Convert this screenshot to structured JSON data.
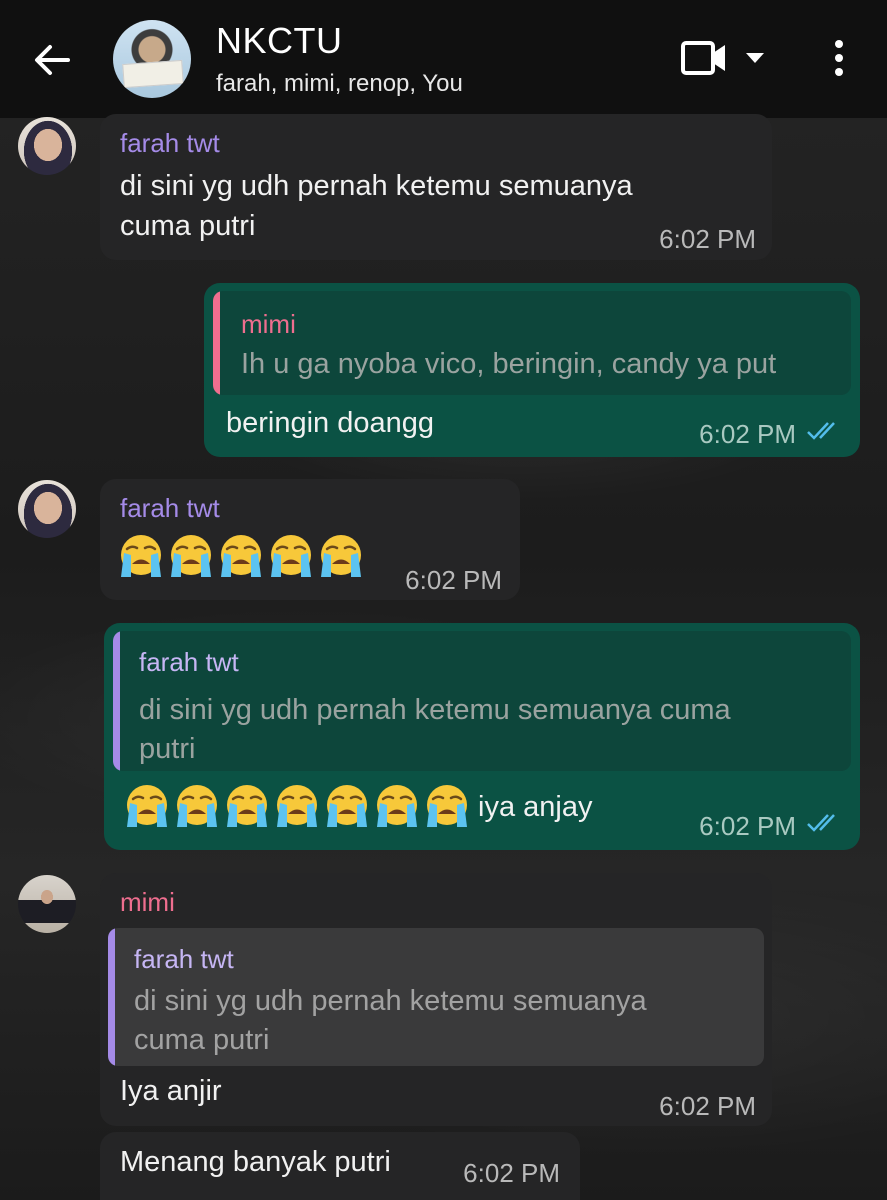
{
  "header": {
    "title": "NKCTU",
    "subtitle": "farah, mimi, renop, You"
  },
  "colors": {
    "header_bg": "#101010",
    "incoming_bubble": "#252526",
    "outgoing_bubble": "#0b5244",
    "farah_name": "#a58be8",
    "mimi_name": "#ef6e8f",
    "read_ticks": "#53bdeb"
  },
  "messages": [
    {
      "sender": "farah twt",
      "text_line1": "di sini yg udh pernah ketemu semuanya",
      "text_line2": "cuma putri",
      "time": "6:02 PM"
    },
    {
      "quote_name": "mimi",
      "quote_text": "Ih u ga nyoba vico, beringin, candy ya put",
      "text": "beringin doangg",
      "time": "6:02 PM"
    },
    {
      "sender": "farah twt",
      "emoji_count": 5,
      "emoji": "loudly-crying-face",
      "time": "6:02 PM"
    },
    {
      "quote_name": "farah twt",
      "quote_line1": "di sini yg udh pernah ketemu semuanya cuma",
      "quote_line2": "putri",
      "emoji_count": 7,
      "text": "iya anjay",
      "time": "6:02 PM"
    },
    {
      "sender": "mimi",
      "quote_name": "farah twt",
      "quote_line1": "di sini yg udh pernah ketemu semuanya",
      "quote_line2": "cuma putri",
      "text": "Iya anjir",
      "time": "6:02 PM"
    },
    {
      "text": "Menang banyak putri",
      "time": "6:02 PM"
    }
  ]
}
